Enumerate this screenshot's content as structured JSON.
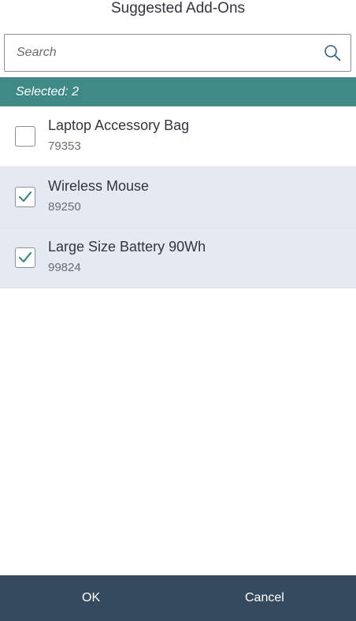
{
  "dialog": {
    "title": "Suggested Add-Ons"
  },
  "search": {
    "placeholder": "Search",
    "value": "",
    "icon": "search-icon"
  },
  "info_bar": {
    "text": "Selected: 2"
  },
  "items": [
    {
      "title": "Laptop Accessory Bag",
      "id": "79353",
      "checked": false
    },
    {
      "title": "Wireless Mouse",
      "id": "89250",
      "checked": true
    },
    {
      "title": "Large Size Battery 90Wh",
      "id": "99824",
      "checked": true
    }
  ],
  "footer": {
    "ok_label": "OK",
    "cancel_label": "Cancel"
  },
  "colors": {
    "accent": "#3f8a86",
    "footer_bg": "#354a5f",
    "selected_row_bg": "#e5eaf2",
    "check_color": "#3f8a86"
  }
}
